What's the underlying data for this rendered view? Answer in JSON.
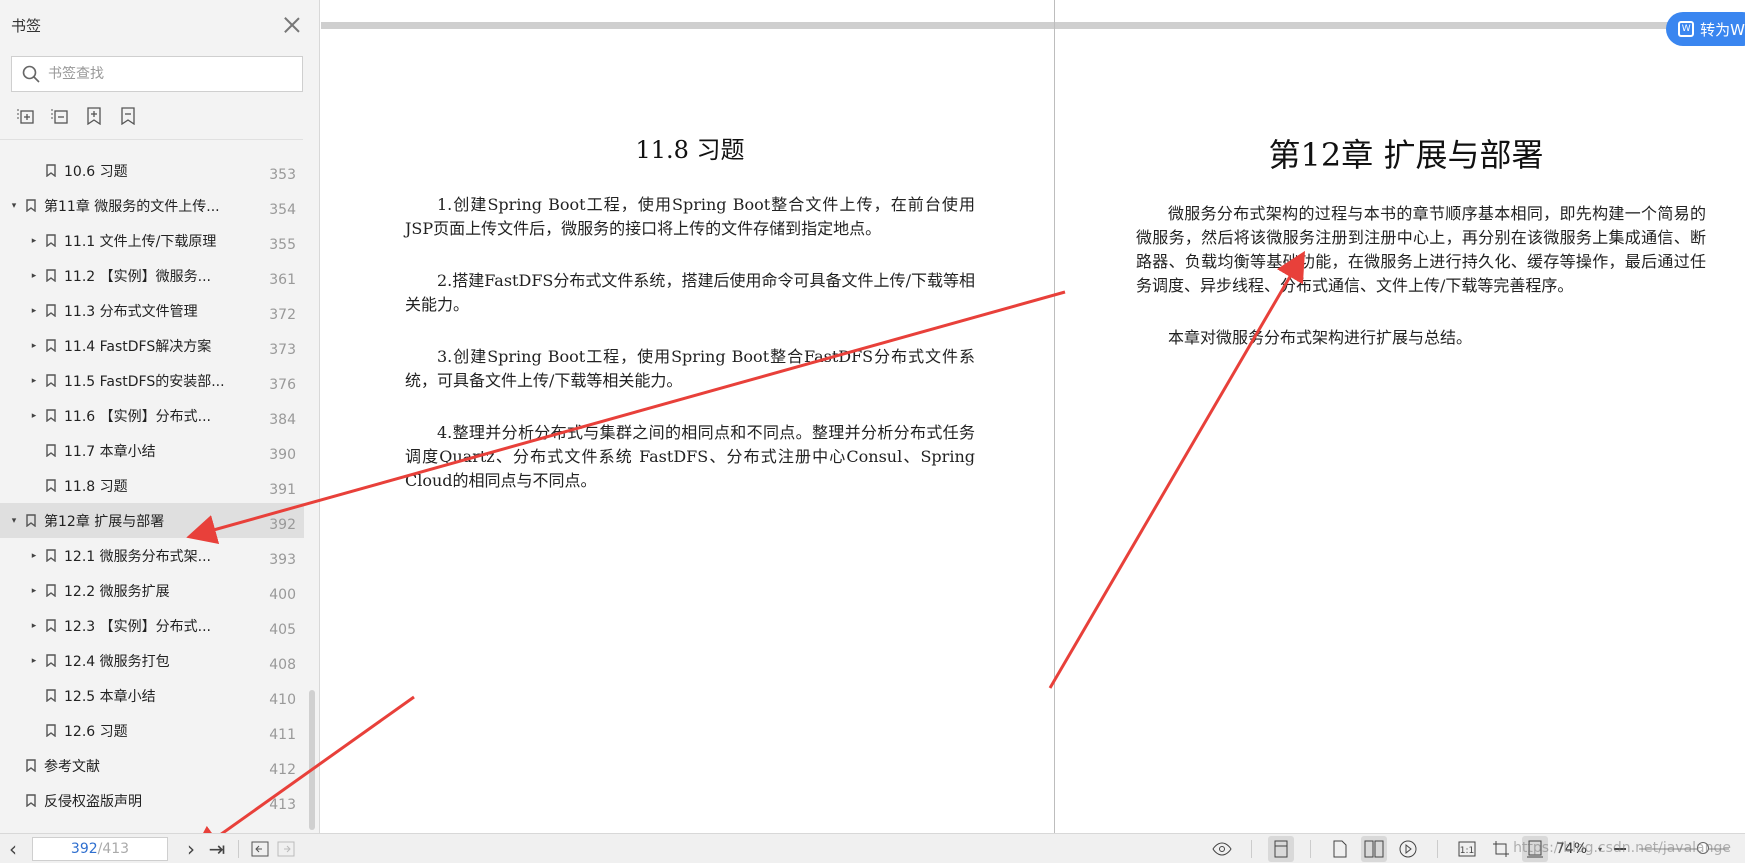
{
  "sidebar": {
    "title": "书签",
    "search_placeholder": "书签查找",
    "items": [
      {
        "label": "10.6 习题",
        "page": "353",
        "level": 1,
        "caret": ""
      },
      {
        "label": "第11章 微服务的文件上传...",
        "page": "354",
        "level": 0,
        "caret": "▾"
      },
      {
        "label": "11.1 文件上传/下载原理",
        "page": "355",
        "level": 1,
        "caret": "▸"
      },
      {
        "label": "11.2 【实例】微服务...",
        "page": "361",
        "level": 1,
        "caret": "▸"
      },
      {
        "label": "11.3 分布式文件管理",
        "page": "372",
        "level": 1,
        "caret": "▸"
      },
      {
        "label": "11.4 FastDFS解决方案",
        "page": "373",
        "level": 1,
        "caret": "▸"
      },
      {
        "label": "11.5 FastDFS的安装部...",
        "page": "376",
        "level": 1,
        "caret": "▸"
      },
      {
        "label": "11.6 【实例】分布式...",
        "page": "384",
        "level": 1,
        "caret": "▸"
      },
      {
        "label": "11.7 本章小结",
        "page": "390",
        "level": 1,
        "caret": ""
      },
      {
        "label": "11.8 习题",
        "page": "391",
        "level": 1,
        "caret": ""
      },
      {
        "label": "第12章 扩展与部署",
        "page": "392",
        "level": 0,
        "caret": "▾"
      },
      {
        "label": "12.1 微服务分布式架...",
        "page": "393",
        "level": 1,
        "caret": "▸"
      },
      {
        "label": "12.2 微服务扩展",
        "page": "400",
        "level": 1,
        "caret": "▸"
      },
      {
        "label": "12.3 【实例】分布式...",
        "page": "405",
        "level": 1,
        "caret": "▸"
      },
      {
        "label": "12.4 微服务打包",
        "page": "408",
        "level": 1,
        "caret": "▸"
      },
      {
        "label": "12.5 本章小结",
        "page": "410",
        "level": 1,
        "caret": ""
      },
      {
        "label": "12.6 习题",
        "page": "411",
        "level": 1,
        "caret": ""
      },
      {
        "label": "参考文献",
        "page": "412",
        "level": 0,
        "caret": ""
      },
      {
        "label": "反侵权盗版声明",
        "page": "413",
        "level": 0,
        "caret": ""
      }
    ]
  },
  "document": {
    "left": {
      "heading": "11.8 习题",
      "paragraphs": [
        "1.创建Spring Boot工程，使用Spring Boot整合文件上传，在前台使用JSP页面上传文件后，微服务的接口将上传的文件存储到指定地点。",
        "2.搭建FastDFS分布式文件系统，搭建后使用命令可具备文件上传/下载等相关能力。",
        "3.创建Spring Boot工程，使用Spring Boot整合FastDFS分布式文件系统，可具备文件上传/下载等相关能力。",
        "4.整理并分析分布式与集群之间的相同点和不同点。整理并分析分布式任务调度Quartz、分布式文件系统 FastDFS、分布式注册中心Consul、Spring Cloud的相同点与不同点。"
      ]
    },
    "right": {
      "heading": "第12章 扩展与部署",
      "paragraphs": [
        "微服务分布式架构的过程与本书的章节顺序基本相同，即先构建一个简易的微服务，然后将该微服务注册到注册中心上，再分别在该微服务上集成通信、断路器、负载均衡等基础功能，在微服务上进行持久化、缓存等操作，最后通过任务调度、异步线程、分布式通信、文件上传/下载等完善程序。",
        "本章对微服务分布式架构进行扩展与总结。"
      ]
    },
    "convert_button": "转为W"
  },
  "statusbar": {
    "current_page": "392",
    "total_pages": "/413",
    "zoom": "74%",
    "watermark": "https://blog.csdn.net/javalange"
  },
  "colors": {
    "accent": "#3a86f0",
    "arrow": "#e8403a",
    "active_row": "#dfdfdf"
  }
}
